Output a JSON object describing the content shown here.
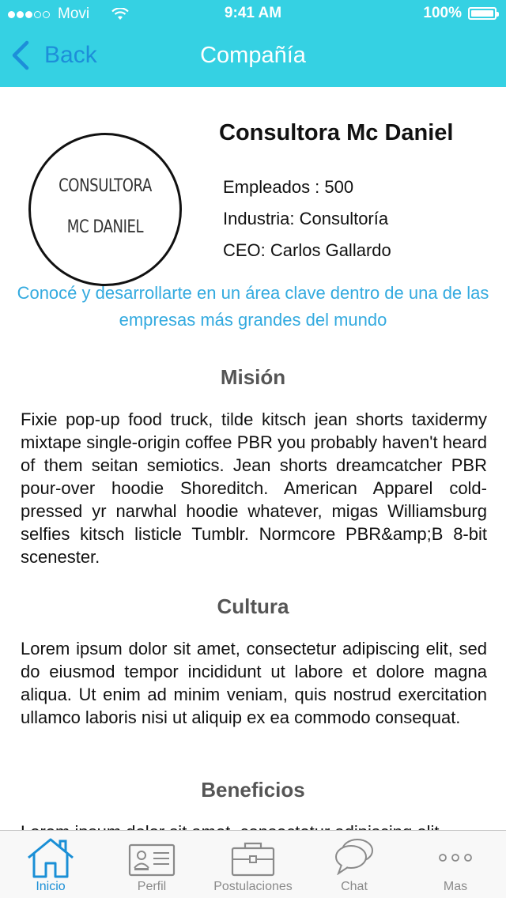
{
  "status_bar": {
    "carrier": "Movi",
    "time": "9:41 AM",
    "battery": "100%"
  },
  "nav": {
    "back_label": "Back",
    "title": "Compañía"
  },
  "company": {
    "logo_line1": "CONSULTORA",
    "logo_line2": "MC DANIEL",
    "name": "Consultora Mc Daniel",
    "employees": "Empleados : 500",
    "industry": "Industria: Consultoría",
    "ceo": "CEO: Carlos Gallardo",
    "tagline": "Conocé y desarrollarte en un área clave dentro de una de las empresas más grandes del mundo"
  },
  "sections": {
    "mision": {
      "title": "Misión",
      "body": "Fixie pop-up food truck, tilde kitsch jean shorts taxidermy mixtape single-origin coffee PBR you probably haven't heard of them seitan semiotics.  Jean shorts dreamcatcher PBR pour-over hoodie Shoreditch. American Apparel cold-pressed yr narwhal hoodie whatever, migas Williamsburg selfies kitsch listicle Tumblr. Normcore PBR&amp;B 8-bit scenester."
    },
    "cultura": {
      "title": "Cultura",
      "body": "Lorem ipsum dolor sit amet, consectetur adipiscing elit, sed do eiusmod tempor incididunt ut labore et dolore magna aliqua. Ut enim ad minim veniam, quis nostrud exercitation ullamco laboris nisi ut aliquip ex ea commodo consequat."
    },
    "beneficios": {
      "title": "Beneficios",
      "body": "Lorem ipsum dolor sit amet, consectetur adipiscing elit"
    }
  },
  "tabbar": {
    "items": [
      {
        "label": "Inicio",
        "icon": "home-icon",
        "active": true
      },
      {
        "label": "Perfil",
        "icon": "id-card-icon"
      },
      {
        "label": "Postulaciones",
        "icon": "briefcase-icon"
      },
      {
        "label": "Chat",
        "icon": "chat-bubbles-icon"
      },
      {
        "label": "Mas",
        "icon": "more-icon"
      }
    ]
  },
  "colors": {
    "header": "#35d1e3",
    "accent": "#1a8fd6",
    "tagline": "#33aadf"
  }
}
